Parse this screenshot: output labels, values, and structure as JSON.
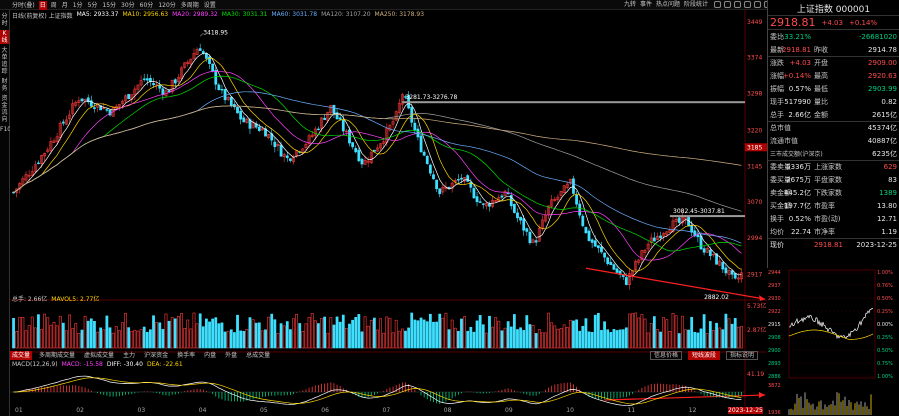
{
  "topbar": {
    "periods": [
      "分时(叠)",
      "日",
      "周",
      "月",
      "1分",
      "5分",
      "15分",
      "30分",
      "60分",
      "120分",
      "多周期",
      "设置"
    ],
    "selected_period": "日",
    "right_buttons": [
      "九转",
      "事件",
      "热点问题",
      "阶段统计"
    ]
  },
  "leftbar": {
    "items": [
      "分时",
      "K线",
      "大单追踪",
      "财务",
      "资金流向",
      "F10"
    ]
  },
  "ma_legend": {
    "label": "日线(前复权) 上证指数",
    "ma5": "MA5: 2933.37",
    "ma10": "MA10: 2956.63",
    "ma20": "MA20: 2989.32",
    "ma30": "MA30: 3031.31",
    "ma60": "MA60: 3031.78",
    "ma120": "MA120: 3107.20",
    "ma250": "MA250: 3178.93"
  },
  "price_axis": [
    "3449",
    "3374",
    "3298",
    "3220",
    "3145",
    "3070",
    "2994",
    "2917"
  ],
  "price_axis_highlight": "3185",
  "annotations": {
    "high": "3418.95",
    "mid": "3281.73-3276.78",
    "low_zone": "3082.45-3037.81",
    "low": "2882.02"
  },
  "volume": {
    "legend": "总手: 2.66亿",
    "mavol": "MAVOL5: 2.77亿",
    "axis_top": "5.73亿",
    "axis_mid": "2.87亿"
  },
  "bottom_tabs": [
    "成交量",
    "多周期成交量",
    "虚拟成交量",
    "主力",
    "沪深资金",
    "换手率",
    "内盘",
    "外盘",
    "总成交量"
  ],
  "bottom_tab_selected": "成交量",
  "sub_buttons": [
    "信息价格",
    "短线波段",
    "指标说明"
  ],
  "sub_button_selected": "短线波段",
  "macd": {
    "legend": "MACD(12,26,9)",
    "macd": "MACD: -15.58",
    "diff": "DIFF: -30.40",
    "dea": "DEA: -22.61",
    "axis_top": "41.19",
    "axis_bottom": "-59.09"
  },
  "months": [
    "01",
    "02",
    "03",
    "04",
    "05",
    "06",
    "07",
    "08",
    "09",
    "10",
    "11",
    "12"
  ],
  "date_tag": "2023-12-25",
  "right_panel": {
    "title": "上证指数 000001",
    "price": "2918.81",
    "change": "+4.03",
    "change_pct": "+0.14%",
    "rows": [
      {
        "l1": "委比",
        "v1": "-33.21%",
        "l2": "",
        "v2": "-26681020"
      },
      {
        "l1": "最新",
        "v1": "2918.81",
        "l2": "昨收",
        "v2": "2914.78"
      },
      {
        "l1": "涨跌",
        "v1": "+4.03",
        "l2": "开盘",
        "v2": "2909.00"
      },
      {
        "l1": "涨幅",
        "v1": "+0.14%",
        "l2": "最高",
        "v2": "2920.63"
      },
      {
        "l1": "振幅",
        "v1": "0.57%",
        "l2": "最低",
        "v2": "2903.99"
      },
      {
        "l1": "现手",
        "v1": "517990",
        "l2": "量比",
        "v2": "0.82"
      },
      {
        "l1": "总手",
        "v1": "2.66亿",
        "l2": "金额",
        "v2": "2615亿"
      },
      {
        "l1": "总市值",
        "v1": "",
        "l2": "",
        "v2": "45374亿"
      },
      {
        "l1": "流通市值",
        "v1": "",
        "l2": "",
        "v2": "40887亿"
      },
      {
        "l1": "三市成交额(沪深京)",
        "v1": "",
        "l2": "",
        "v2": "6235亿"
      },
      {
        "l1": "委卖量",
        "v1": "5336万",
        "l2": "上涨家数",
        "v2": "629"
      },
      {
        "l1": "委买量",
        "v1": "2675万",
        "l2": "平盘家数",
        "v2": "83"
      },
      {
        "l1": "卖金额",
        "v1": "445.2亿",
        "l2": "下跌家数",
        "v2": "1389"
      },
      {
        "l1": "买金额",
        "v1": "197.7亿",
        "l2": "市盈率",
        "v2": "13.80"
      },
      {
        "l1": "换手",
        "v1": "0.52%",
        "l2": "市盈(动)",
        "v2": "12.71"
      },
      {
        "l1": "均价",
        "v1": "22.74",
        "l2": "市净率",
        "v2": "1.19"
      }
    ],
    "footer_label": "现价",
    "footer_price": "2918.81",
    "footer_date": "2023-12-25"
  },
  "mini_chart": {
    "axis_left": [
      "2944",
      "2937",
      "2930",
      "2922",
      "2915",
      "2908",
      "2900",
      "2893",
      "2886"
    ],
    "axis_right": [
      "1.00%",
      "0.76%",
      "0.50%",
      "0.25%",
      "0.00%",
      "0.25%",
      "0.50%",
      "0.75%",
      "1.00%"
    ],
    "vol_top": "3872",
    "vol_bottom": "1936"
  },
  "colors": {
    "up": "#ff3b3b",
    "down": "#3fe0ff",
    "ma5": "#ffffff",
    "ma10": "#ffd700",
    "ma20": "#ff40ff",
    "ma30": "#00e000",
    "ma60": "#6ab0ff",
    "ma120": "#a0a0a0",
    "ma250": "#d0b080"
  }
}
